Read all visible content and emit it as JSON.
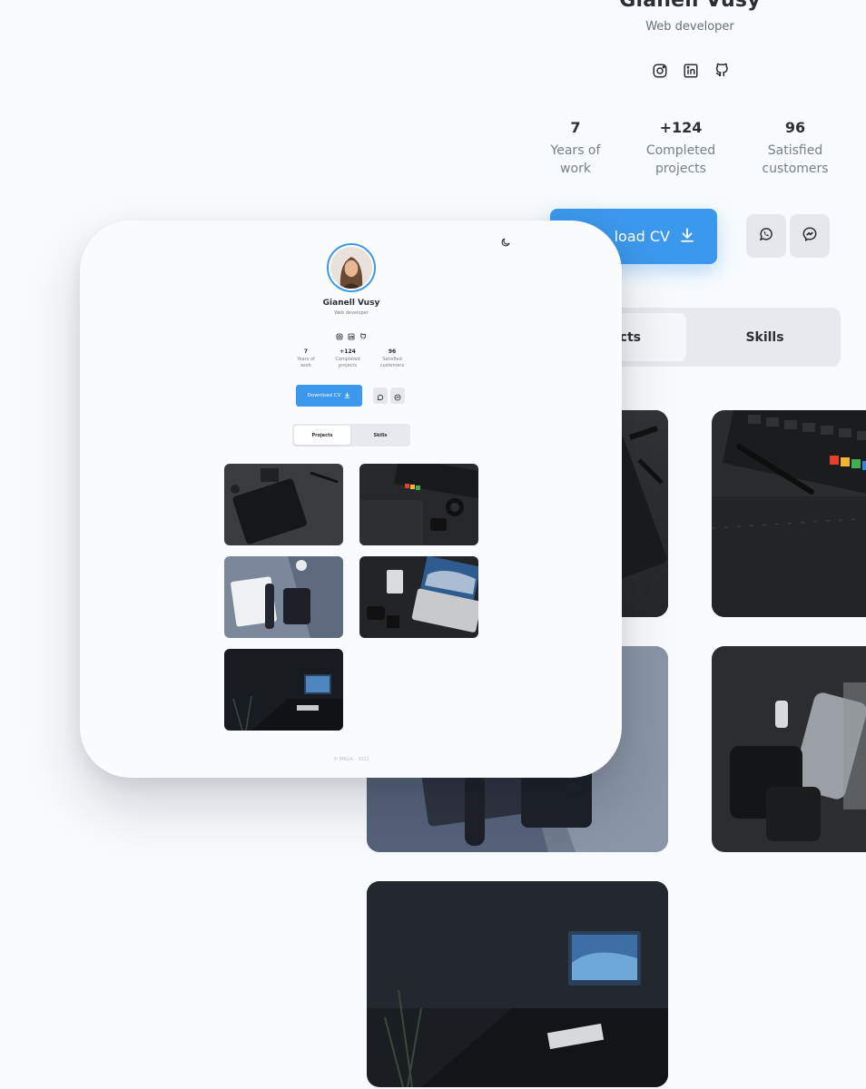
{
  "profile": {
    "name": "Gianell Vusy",
    "role": "Web developer"
  },
  "socials": [
    {
      "name": "instagram-icon"
    },
    {
      "name": "linkedin-icon"
    },
    {
      "name": "github-icon"
    }
  ],
  "stats": [
    {
      "value": "7",
      "label_line1": "Years of",
      "label_line2": "work"
    },
    {
      "value": "+124",
      "label_line1": "Completed",
      "label_line2": "projects"
    },
    {
      "value": "96",
      "label_line1": "Satisfied",
      "label_line2": "customers"
    }
  ],
  "actions": {
    "download_cv": "Download CV",
    "download_cv_partial": "load CV",
    "whatsapp_icon": "whatsapp-icon",
    "messenger_icon": "messenger-icon"
  },
  "tabs": {
    "projects": "Projects",
    "projects_partial": "cts",
    "skills": "Skills"
  },
  "footer": "© MRGA - 2022",
  "colors": {
    "accent": "#3c98ec",
    "page_bg": "#f8fbfd",
    "tab_bg": "#e6e9ed"
  }
}
